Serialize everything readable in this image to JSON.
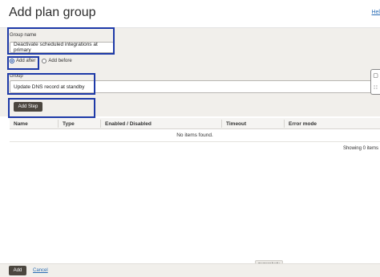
{
  "header": {
    "title": "Add plan group",
    "help_link": "Hel"
  },
  "form": {
    "group_name_label": "Group name",
    "group_name_value": "Deactivate scheduled integrations at primary",
    "position_options": [
      {
        "label": "Add after",
        "checked": true
      },
      {
        "label": "Add before",
        "checked": false
      }
    ],
    "group_label": "Group",
    "group_value": "Update DNS record at standby",
    "add_step_label": "Add Step"
  },
  "table": {
    "columns": [
      "Name",
      "Type",
      "Enabled / Disabled",
      "Timeout",
      "Error mode"
    ],
    "empty_message": "No items found.",
    "footer": "Showing 0 items"
  },
  "footer": {
    "add_label": "Add",
    "cancel_label": "Cancel",
    "content_tag": "Content body"
  },
  "colors": {
    "highlight": "#1e3aa8",
    "primary_button": "#4b463f",
    "link": "#2a6db5",
    "form_background": "#f1efeb"
  },
  "icons": [
    "toolbar-icon",
    "grid-icon"
  ]
}
